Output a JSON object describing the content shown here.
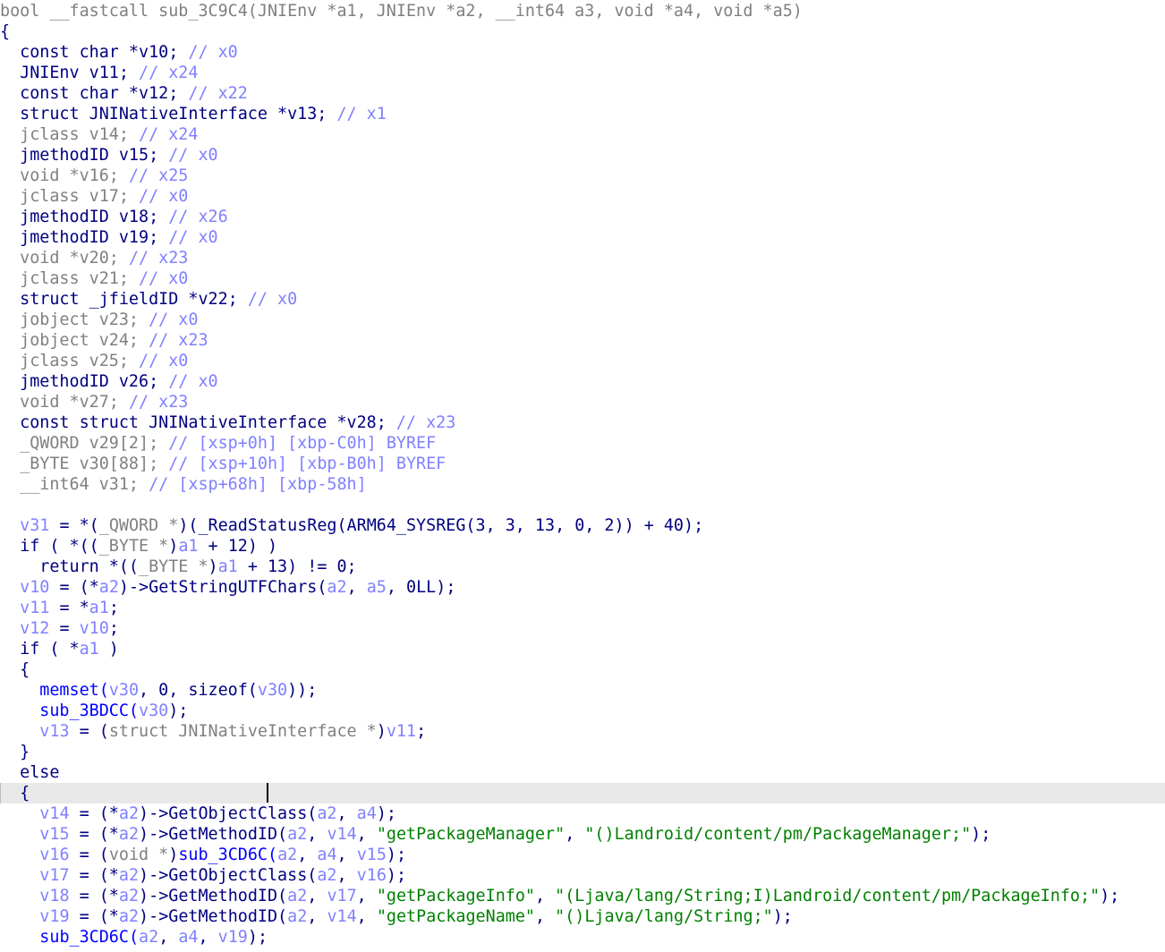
{
  "editor": {
    "title": "IDA pseudocode view",
    "highlighted_line": 38,
    "lines": [
      [
        [
          "bool __fastcall sub_3C9C4(JNIEnv *a1, JNIEnv *a2, __int64 a3, void *a4, void *a5)",
          "g"
        ]
      ],
      [
        [
          "{",
          "n"
        ]
      ],
      [
        [
          "  const char *v10; ",
          "n"
        ],
        [
          "// x0",
          "c"
        ]
      ],
      [
        [
          "  JNIEnv v11; ",
          "n"
        ],
        [
          "// x24",
          "c"
        ]
      ],
      [
        [
          "  const char *v12; ",
          "n"
        ],
        [
          "// x22",
          "c"
        ]
      ],
      [
        [
          "  struct JNINativeInterface *v13; ",
          "n"
        ],
        [
          "// x1",
          "c"
        ]
      ],
      [
        [
          "  jclass v14; ",
          "g"
        ],
        [
          "// x24",
          "c"
        ]
      ],
      [
        [
          "  jmethodID v15; ",
          "n"
        ],
        [
          "// x0",
          "c"
        ]
      ],
      [
        [
          "  void *v16; ",
          "g"
        ],
        [
          "// x25",
          "c"
        ]
      ],
      [
        [
          "  jclass v17; ",
          "g"
        ],
        [
          "// x0",
          "c"
        ]
      ],
      [
        [
          "  jmethodID v18; ",
          "n"
        ],
        [
          "// x26",
          "c"
        ]
      ],
      [
        [
          "  jmethodID v19; ",
          "n"
        ],
        [
          "// x0",
          "c"
        ]
      ],
      [
        [
          "  void *v20; ",
          "g"
        ],
        [
          "// x23",
          "c"
        ]
      ],
      [
        [
          "  jclass v21; ",
          "g"
        ],
        [
          "// x0",
          "c"
        ]
      ],
      [
        [
          "  struct _jfieldID *v22; ",
          "n"
        ],
        [
          "// x0",
          "c"
        ]
      ],
      [
        [
          "  jobject v23; ",
          "g"
        ],
        [
          "// x0",
          "c"
        ]
      ],
      [
        [
          "  jobject v24; ",
          "g"
        ],
        [
          "// x23",
          "c"
        ]
      ],
      [
        [
          "  jclass v25; ",
          "g"
        ],
        [
          "// x0",
          "c"
        ]
      ],
      [
        [
          "  jmethodID v26; ",
          "n"
        ],
        [
          "// x0",
          "c"
        ]
      ],
      [
        [
          "  void *v27; ",
          "g"
        ],
        [
          "// x23",
          "c"
        ]
      ],
      [
        [
          "  const struct JNINativeInterface *v28; ",
          "n"
        ],
        [
          "// x23",
          "c"
        ]
      ],
      [
        [
          "  _QWORD v29[2]; ",
          "g"
        ],
        [
          "// [xsp+0h] [xbp-C0h] BYREF",
          "c"
        ]
      ],
      [
        [
          "  _BYTE v30[88]; ",
          "g"
        ],
        [
          "// [xsp+10h] [xbp-B0h] BYREF",
          "c"
        ]
      ],
      [
        [
          "  __int64 v31; ",
          "g"
        ],
        [
          "// [xsp+68h] [xbp-58h]",
          "c"
        ]
      ],
      [
        [
          "",
          "n"
        ]
      ],
      [
        [
          "  ",
          "n"
        ],
        [
          "v31",
          "c"
        ],
        [
          " = *(",
          "n"
        ],
        [
          "_QWORD *",
          "g"
        ],
        [
          ")(_ReadStatusReg(ARM64_SYSREG(3, 3, 13, 0, 2)) + 40);",
          "n"
        ]
      ],
      [
        [
          "  if ( *((",
          "n"
        ],
        [
          "_BYTE *",
          "g"
        ],
        [
          ")",
          "n"
        ],
        [
          "a1",
          "c"
        ],
        [
          " + 12) )",
          "n"
        ]
      ],
      [
        [
          "    return *((",
          "n"
        ],
        [
          "_BYTE *",
          "g"
        ],
        [
          ")",
          "n"
        ],
        [
          "a1",
          "c"
        ],
        [
          " + 13) != 0;",
          "n"
        ]
      ],
      [
        [
          "  ",
          "n"
        ],
        [
          "v10",
          "c"
        ],
        [
          " = (*",
          "n"
        ],
        [
          "a2",
          "c"
        ],
        [
          ")->GetStringUTFChars(",
          "n"
        ],
        [
          "a2",
          "c"
        ],
        [
          ", ",
          "n"
        ],
        [
          "a5",
          "c"
        ],
        [
          ", 0LL);",
          "n"
        ]
      ],
      [
        [
          "  ",
          "n"
        ],
        [
          "v11",
          "c"
        ],
        [
          " = *",
          "n"
        ],
        [
          "a1",
          "c"
        ],
        [
          ";",
          "n"
        ]
      ],
      [
        [
          "  ",
          "n"
        ],
        [
          "v12",
          "c"
        ],
        [
          " = ",
          "n"
        ],
        [
          "v10",
          "c"
        ],
        [
          ";",
          "n"
        ]
      ],
      [
        [
          "  if ( *",
          "n"
        ],
        [
          "a1",
          "c"
        ],
        [
          " )",
          "n"
        ]
      ],
      [
        [
          "  {",
          "n"
        ]
      ],
      [
        [
          "    memset(",
          "h"
        ],
        [
          "v30",
          "c"
        ],
        [
          ", 0, sizeof(",
          "n"
        ],
        [
          "v30",
          "c"
        ],
        [
          "));",
          "n"
        ]
      ],
      [
        [
          "    sub_3BDCC(",
          "h"
        ],
        [
          "v30",
          "c"
        ],
        [
          ");",
          "n"
        ]
      ],
      [
        [
          "    ",
          "n"
        ],
        [
          "v13",
          "c"
        ],
        [
          " = (",
          "n"
        ],
        [
          "struct JNINativeInterface *",
          "g"
        ],
        [
          ")",
          "n"
        ],
        [
          "v11",
          "c"
        ],
        [
          ";",
          "n"
        ]
      ],
      [
        [
          "  }",
          "n"
        ]
      ],
      [
        [
          "  else",
          "n"
        ]
      ],
      [
        [
          "  {",
          "n"
        ]
      ],
      [
        [
          "    ",
          "n"
        ],
        [
          "v14",
          "c"
        ],
        [
          " = (*",
          "n"
        ],
        [
          "a2",
          "c"
        ],
        [
          ")->GetObjectClass(",
          "n"
        ],
        [
          "a2",
          "c"
        ],
        [
          ", ",
          "n"
        ],
        [
          "a4",
          "c"
        ],
        [
          ");",
          "n"
        ]
      ],
      [
        [
          "    ",
          "n"
        ],
        [
          "v15",
          "c"
        ],
        [
          " = (*",
          "n"
        ],
        [
          "a2",
          "c"
        ],
        [
          ")->GetMethodID(",
          "n"
        ],
        [
          "a2",
          "c"
        ],
        [
          ", ",
          "n"
        ],
        [
          "v14",
          "c"
        ],
        [
          ", ",
          "n"
        ],
        [
          "\"getPackageManager\"",
          "s"
        ],
        [
          ", ",
          "n"
        ],
        [
          "\"()Landroid/content/pm/PackageManager;\"",
          "s"
        ],
        [
          ");",
          "n"
        ]
      ],
      [
        [
          "    ",
          "n"
        ],
        [
          "v16",
          "c"
        ],
        [
          " = (",
          "n"
        ],
        [
          "void *",
          "g"
        ],
        [
          ")",
          "n"
        ],
        [
          "sub_3CD6C(",
          "h"
        ],
        [
          "a2",
          "c"
        ],
        [
          ", ",
          "n"
        ],
        [
          "a4",
          "c"
        ],
        [
          ", ",
          "n"
        ],
        [
          "v15",
          "c"
        ],
        [
          ");",
          "n"
        ]
      ],
      [
        [
          "    ",
          "n"
        ],
        [
          "v17",
          "c"
        ],
        [
          " = (*",
          "n"
        ],
        [
          "a2",
          "c"
        ],
        [
          ")->GetObjectClass(",
          "n"
        ],
        [
          "a2",
          "c"
        ],
        [
          ", ",
          "n"
        ],
        [
          "v16",
          "c"
        ],
        [
          ");",
          "n"
        ]
      ],
      [
        [
          "    ",
          "n"
        ],
        [
          "v18",
          "c"
        ],
        [
          " = (*",
          "n"
        ],
        [
          "a2",
          "c"
        ],
        [
          ")->GetMethodID(",
          "n"
        ],
        [
          "a2",
          "c"
        ],
        [
          ", ",
          "n"
        ],
        [
          "v17",
          "c"
        ],
        [
          ", ",
          "n"
        ],
        [
          "\"getPackageInfo\"",
          "s"
        ],
        [
          ", ",
          "n"
        ],
        [
          "\"(Ljava/lang/String;I)Landroid/content/pm/PackageInfo;\"",
          "s"
        ],
        [
          ");",
          "n"
        ]
      ],
      [
        [
          "    ",
          "n"
        ],
        [
          "v19",
          "c"
        ],
        [
          " = (*",
          "n"
        ],
        [
          "a2",
          "c"
        ],
        [
          ")->GetMethodID(",
          "n"
        ],
        [
          "a2",
          "c"
        ],
        [
          ", ",
          "n"
        ],
        [
          "v14",
          "c"
        ],
        [
          ", ",
          "n"
        ],
        [
          "\"getPackageName\"",
          "s"
        ],
        [
          ", ",
          "n"
        ],
        [
          "\"()Ljava/lang/String;\"",
          "s"
        ],
        [
          ");",
          "n"
        ]
      ],
      [
        [
          "    ",
          "n"
        ],
        [
          "sub_3CD6C(",
          "h"
        ],
        [
          "a2",
          "c"
        ],
        [
          ", ",
          "n"
        ],
        [
          "a4",
          "c"
        ],
        [
          ", ",
          "n"
        ],
        [
          "v19",
          "c"
        ],
        [
          ");",
          "n"
        ]
      ]
    ]
  }
}
